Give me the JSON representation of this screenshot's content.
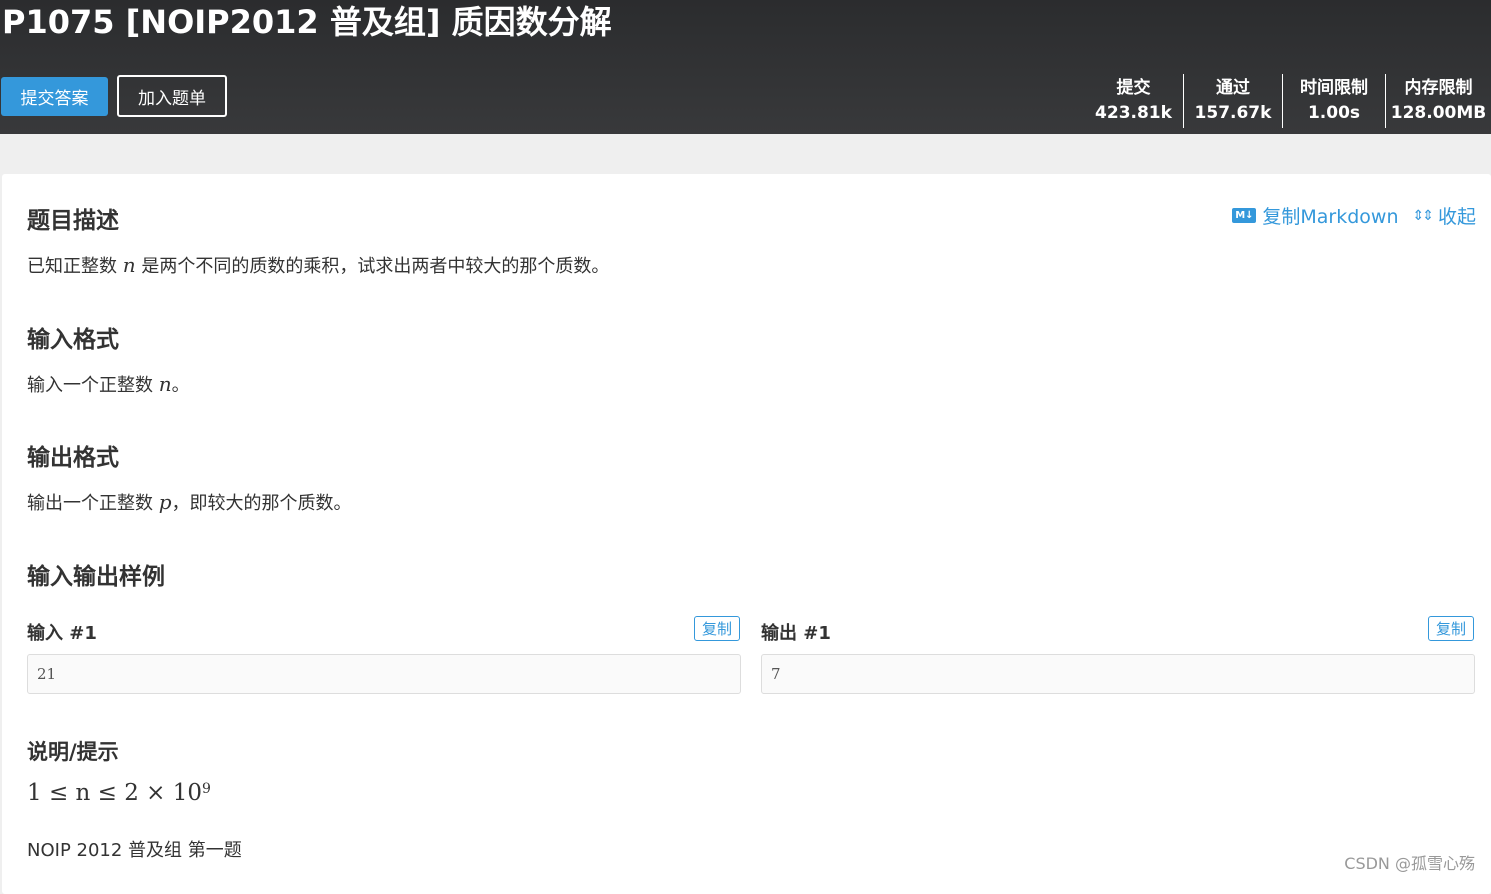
{
  "header": {
    "title": "P1075 [NOIP2012 普及组] 质因数分解",
    "submit_label": "提交答案",
    "add_label": "加入题单",
    "stats": [
      {
        "label": "提交",
        "value": "423.81k"
      },
      {
        "label": "通过",
        "value": "157.67k"
      },
      {
        "label": "时间限制",
        "value": "1.00s"
      },
      {
        "label": "内存限制",
        "value": "128.00MB"
      }
    ]
  },
  "actions": {
    "md_icon_text": "M↓",
    "copy_markdown": "复制Markdown",
    "collapse_icon_text": "⇕⇕",
    "collapse": "收起"
  },
  "description": {
    "heading": "题目描述",
    "text_before": "已知正整数 ",
    "var": "n",
    "text_after": " 是两个不同的质数的乘积，试求出两者中较大的那个质数。"
  },
  "input_format": {
    "heading": "输入格式",
    "text_before": "输入一个正整数 ",
    "var": "n",
    "text_after": "。"
  },
  "output_format": {
    "heading": "输出格式",
    "text_before": "输出一个正整数 ",
    "var": "p",
    "text_after": "，即较大的那个质数。"
  },
  "samples": {
    "heading": "输入输出样例",
    "input_label": "输入 #1",
    "output_label": "输出 #1",
    "copy_label": "复制",
    "input_value": "21",
    "output_value": "7"
  },
  "hint": {
    "heading": "说明/提示",
    "math": "1 ≤ n ≤ 2 × 10",
    "exponent": "9",
    "source": "NOIP 2012 普及组 第一题"
  },
  "watermark": "CSDN @孤雪心殇"
}
